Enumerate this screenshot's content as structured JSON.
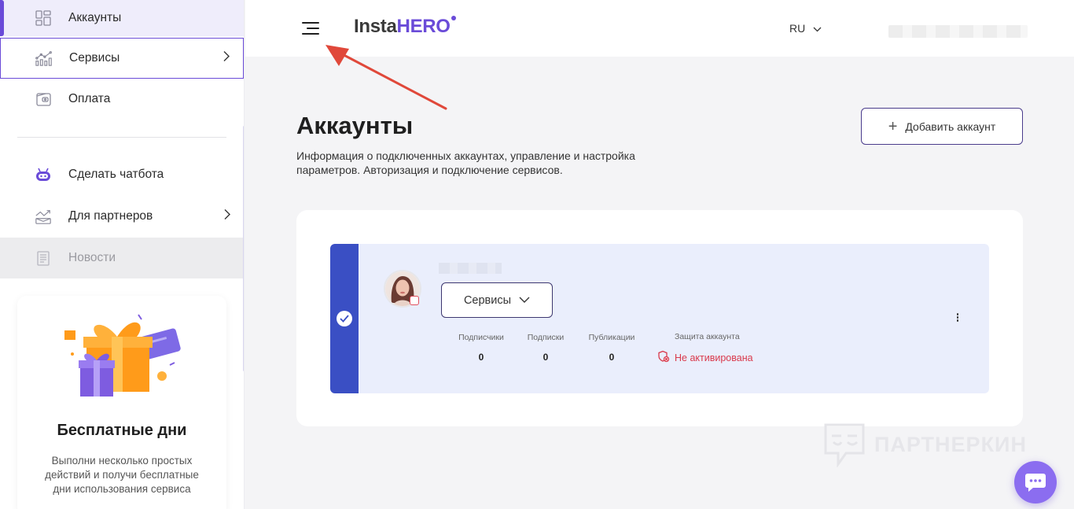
{
  "sidebar": {
    "items": [
      {
        "label": "Аккаунты",
        "icon": "dashboard-icon"
      },
      {
        "label": "Сервисы",
        "icon": "services-chart-icon"
      },
      {
        "label": "Оплата",
        "icon": "wallet-icon"
      },
      {
        "label": "Сделать чатбота",
        "icon": "robot-icon"
      },
      {
        "label": "Для партнеров",
        "icon": "partners-chart-icon"
      },
      {
        "label": "Новости",
        "icon": "news-icon"
      }
    ],
    "promo": {
      "title": "Бесплатные дни",
      "text": "Выполни несколько простых действий и получи бесплатные дни использования сервиса"
    }
  },
  "header": {
    "logo_part1": "Insta",
    "logo_part2": "HERO",
    "language": "RU"
  },
  "main": {
    "title": "Аккаунты",
    "description": "Информация о подключенных аккаунтах, управление и настройка параметров. Авторизация и подключение сервисов.",
    "add_account_label": "Добавить аккаунт",
    "account": {
      "services_label": "Сервисы",
      "stats": [
        {
          "label": "Подписчики",
          "value": "0"
        },
        {
          "label": "Подписки",
          "value": "0"
        },
        {
          "label": "Публикации",
          "value": "0"
        }
      ],
      "protection_label": "Защита аккаунта",
      "protection_status": "Не активирована"
    }
  },
  "watermark": "ПАРТНЕРКИН",
  "colors": {
    "accent": "#6a4bd8",
    "card_strip": "#3a4fc4",
    "card_bg": "#eaeefc",
    "danger": "#d9394b",
    "arrow": "#e0483a"
  }
}
